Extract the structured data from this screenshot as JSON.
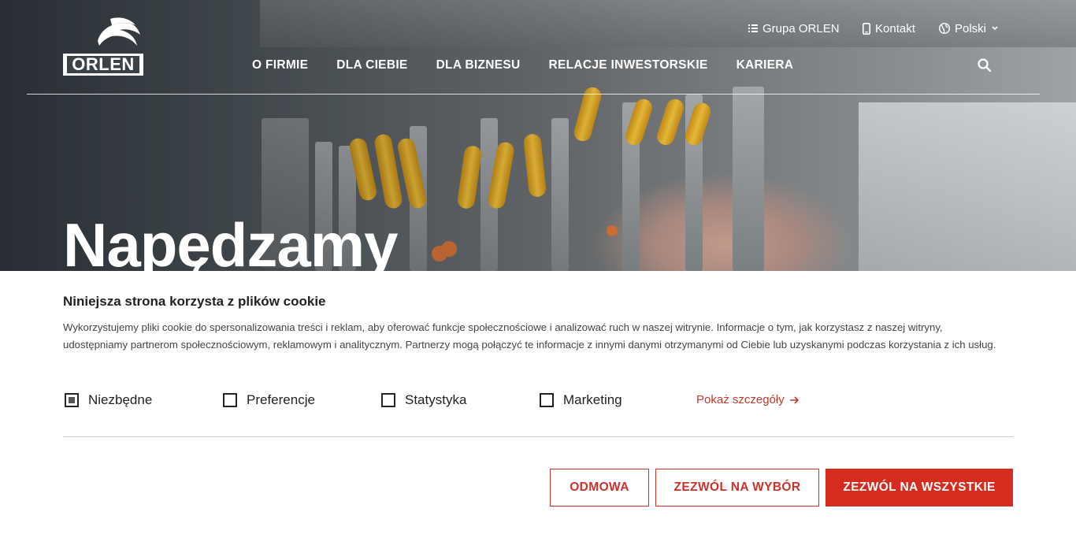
{
  "brand": {
    "logo_text": "ORLEN"
  },
  "topnav": {
    "group": "Grupa ORLEN",
    "contact": "Kontakt",
    "language": "Polski"
  },
  "mainnav": [
    "O FIRMIE",
    "DLA CIEBIE",
    "DLA BIZNESU",
    "RELACJE INWESTORSKIE",
    "KARIERA"
  ],
  "hero": {
    "headline": "Napędzamy"
  },
  "cookie": {
    "title": "Niniejsza strona korzysta z plików cookie",
    "description": "Wykorzystujemy pliki cookie do spersonalizowania treści i reklam, aby oferować funkcje społecznościowe i analizować ruch w naszej witrynie. Informacje o tym, jak korzystasz z naszej witryny, udostępniamy partnerom społecznościowym, reklamowym i analitycznym. Partnerzy mogą połączyć te informacje z innymi danymi otrzymanymi od Ciebie lub uzyskanymi podczas korzystania z ich usług.",
    "options": [
      {
        "label": "Niezbędne",
        "checked": true
      },
      {
        "label": "Preferencje",
        "checked": false
      },
      {
        "label": "Statystyka",
        "checked": false
      },
      {
        "label": "Marketing",
        "checked": false
      }
    ],
    "details_link": "Pokaż szczegóły",
    "buttons": {
      "deny": "ODMOWA",
      "allow_selection": "ZEZWÓL NA WYBÓR",
      "allow_all": "ZEZWÓL NA WSZYSTKIE"
    }
  },
  "colors": {
    "accent": "#d62c1f",
    "accent_text": "#c0392b"
  }
}
